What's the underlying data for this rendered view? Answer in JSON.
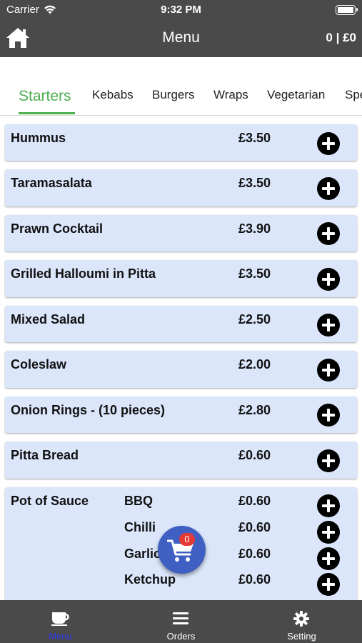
{
  "status_bar": {
    "carrier": "Carrier",
    "time": "9:32 PM"
  },
  "navbar": {
    "title": "Menu",
    "cart_total": "0 | £0"
  },
  "tabs": [
    {
      "label": "Starters",
      "active": true
    },
    {
      "label": "Kebabs",
      "active": false
    },
    {
      "label": "Burgers",
      "active": false
    },
    {
      "label": "Wraps",
      "active": false
    },
    {
      "label": "Vegetarian",
      "active": false
    },
    {
      "label": "Spe",
      "active": false
    }
  ],
  "items": [
    {
      "name": "Hummus",
      "price": "£3.50"
    },
    {
      "name": "Taramasalata",
      "price": "£3.50"
    },
    {
      "name": "Prawn Cocktail",
      "price": "£3.90"
    },
    {
      "name": "Grilled Halloumi in Pitta",
      "price": "£3.50"
    },
    {
      "name": "Mixed Salad",
      "price": "£2.50"
    },
    {
      "name": "Coleslaw",
      "price": "£2.00"
    },
    {
      "name": "Onion Rings - (10 pieces)",
      "price": "£2.80"
    },
    {
      "name": "Pitta Bread",
      "price": "£0.60"
    }
  ],
  "sauce": {
    "name": "Pot of Sauce",
    "options": [
      {
        "name": "BBQ",
        "price": "£0.60"
      },
      {
        "name": "Chilli",
        "price": "£0.60"
      },
      {
        "name": "Garlic",
        "price": "£0.60"
      },
      {
        "name": "Ketchup",
        "price": "£0.60"
      }
    ]
  },
  "cart_fab": {
    "badge": "0",
    "icon": "cart-icon"
  },
  "tab_bar": [
    {
      "label": "Menu",
      "icon": "coffee-cup-icon",
      "active": true
    },
    {
      "label": "Orders",
      "icon": "list-icon",
      "active": false
    },
    {
      "label": "Setting",
      "icon": "gear-icon",
      "active": false
    }
  ],
  "colors": {
    "bar": "#4a4a4a",
    "accent_green": "#4caf50",
    "item_bg": "#dbe6fb",
    "fab": "#3f5fc2",
    "badge": "#e53935",
    "active_tab_label": "#2f3df0"
  }
}
